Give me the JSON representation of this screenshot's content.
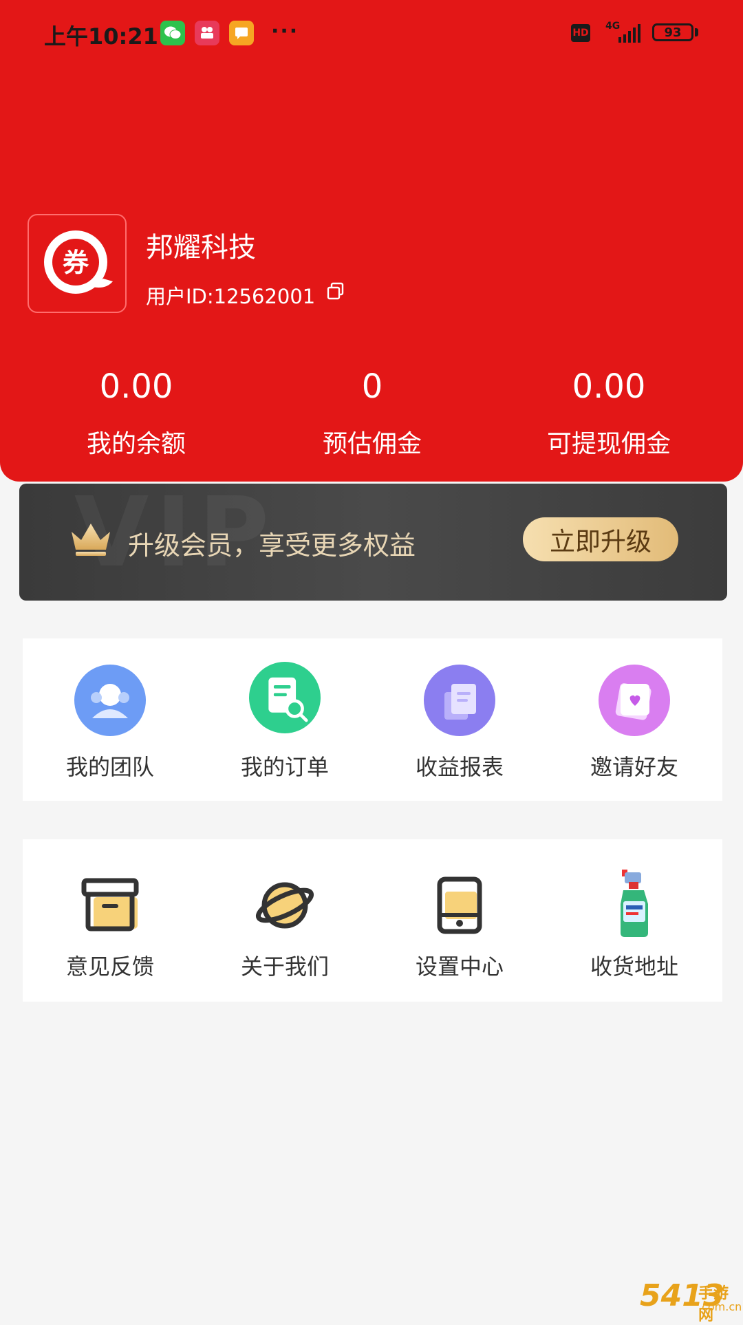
{
  "status_bar": {
    "time": "上午10:21",
    "network": "4G",
    "hd": "HD",
    "battery": "93",
    "overflow": "···"
  },
  "profile": {
    "name": "邦耀科技",
    "user_id": "用户ID:12562001",
    "logo_text": "券"
  },
  "stats": [
    {
      "value": "0.00",
      "label": "我的余额"
    },
    {
      "value": "0",
      "label": "预估佣金"
    },
    {
      "value": "0.00",
      "label": "可提现佣金"
    }
  ],
  "vip_banner": {
    "watermark": "VIP",
    "text": "升级会员，享受更多权益",
    "button": "立即升级"
  },
  "grid_primary": [
    {
      "label": "我的团队",
      "icon": "team-icon",
      "color": "#6d9cf5"
    },
    {
      "label": "我的订单",
      "icon": "order-search-icon",
      "color": "#2ecf8e"
    },
    {
      "label": "收益报表",
      "icon": "report-icon",
      "color": "#8b7ef0"
    },
    {
      "label": "邀请好友",
      "icon": "invite-card-icon",
      "color": "#d97ef0"
    }
  ],
  "grid_secondary": [
    {
      "label": "意见反馈",
      "icon": "feedback-box-icon"
    },
    {
      "label": "关于我们",
      "icon": "planet-icon"
    },
    {
      "label": "设置中心",
      "icon": "phone-settings-icon"
    },
    {
      "label": "收货地址",
      "icon": "spray-bottle-icon"
    }
  ],
  "site_watermark": {
    "brand": "5413",
    "text": "手游网",
    "domain": ".com.cn"
  },
  "colors": {
    "header_red": "#e31717",
    "gold": "#e2bb78",
    "background": "#f5f5f5"
  }
}
